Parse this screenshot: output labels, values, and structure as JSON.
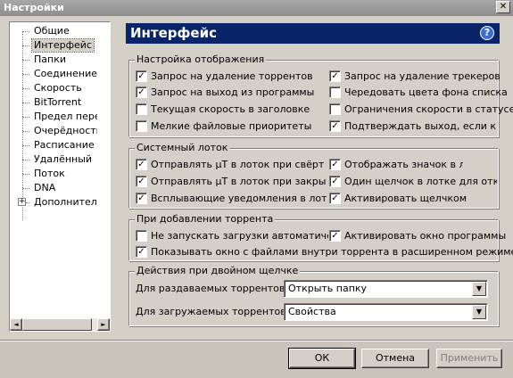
{
  "window": {
    "title": "Настройки",
    "close_glyph": "✕"
  },
  "tree": {
    "items": [
      {
        "label": "Общие"
      },
      {
        "label": "Интерфейс",
        "selected": true
      },
      {
        "label": "Папки"
      },
      {
        "label": "Соединение"
      },
      {
        "label": "Скорость"
      },
      {
        "label": "BitTorrent"
      },
      {
        "label": "Предел передачи"
      },
      {
        "label": "Очерёдность"
      },
      {
        "label": "Расписание"
      },
      {
        "label": "Удалённый"
      },
      {
        "label": "Поток"
      },
      {
        "label": "DNA"
      },
      {
        "label": "Дополнительно",
        "expander": "+"
      }
    ],
    "hscroll_left": "◄",
    "hscroll_right": "►"
  },
  "panel": {
    "title": "Интерфейс",
    "help_glyph": "?"
  },
  "display_settings": {
    "legend": "Настройка отображения",
    "items": [
      {
        "label": "Запрос на удаление торрентов",
        "checked": true
      },
      {
        "label": "Запрос на удаление трекеров",
        "checked": true
      },
      {
        "label": "Запрос на выход из программы",
        "checked": true
      },
      {
        "label": "Чередовать цвета фона списка",
        "checked": false
      },
      {
        "label": "Текущая скорость в заголовке",
        "checked": false
      },
      {
        "label": "Ограничения скорости в статусе",
        "checked": false
      },
      {
        "label": "Мелкие файловые приоритеты",
        "checked": false
      },
      {
        "label": "Подтверждать выход, если крити",
        "checked": true
      }
    ]
  },
  "system_tray": {
    "legend": "Системный лоток",
    "items": [
      {
        "label": "Отправлять µT в лоток при свёрт",
        "checked": true
      },
      {
        "label": "Отображать значок в лотк",
        "checked": true
      },
      {
        "label": "Отправлять µT в лоток при закрытии",
        "checked": true
      },
      {
        "label": "Один щелчок в лотке для открыт",
        "checked": true
      },
      {
        "label": "Всплывающие уведомления в лотке",
        "checked": true
      },
      {
        "label": "Активировать щелчком",
        "checked": true
      }
    ]
  },
  "on_add": {
    "legend": "При добавлении торрента",
    "items": [
      {
        "label": "Не запускать загрузки автоматически",
        "checked": false
      },
      {
        "label": "Активировать окно программы",
        "checked": true
      },
      {
        "label": "Показывать окно с файлами внутри торрента в расширенном режиме",
        "checked": true
      }
    ]
  },
  "double_click": {
    "legend": "Действия при двойном щелчке",
    "seeding_label": "Для раздаваемых торрентов:",
    "seeding_value": "Открыть папку",
    "downloading_label": "Для загружаемых торрентов:",
    "downloading_value": "Свойства",
    "arrow_glyph": "▼"
  },
  "buttons": {
    "ok": "ОК",
    "cancel": "Отмена",
    "apply": "Применить"
  },
  "check_glyph": "✓"
}
